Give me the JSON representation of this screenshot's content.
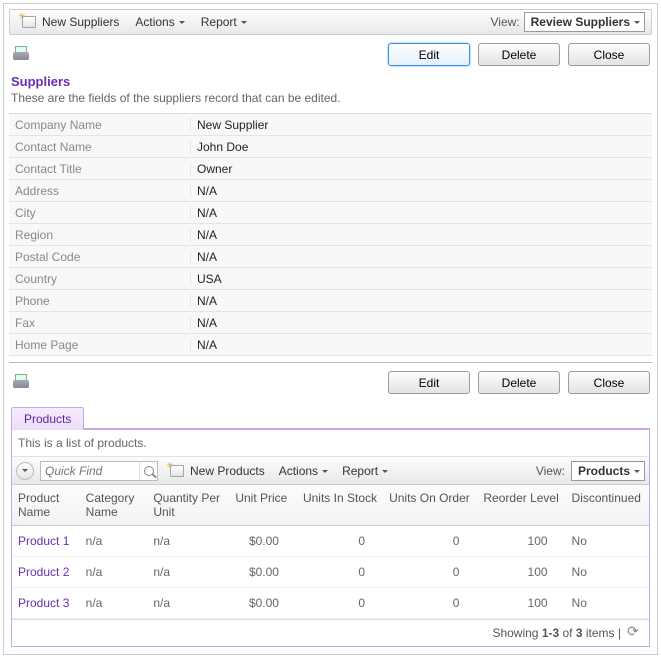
{
  "topToolbar": {
    "newSuppliers": "New Suppliers",
    "actions": "Actions",
    "report": "Report",
    "viewLabel": "View:",
    "viewValue": "Review Suppliers"
  },
  "supplierActions": {
    "edit": "Edit",
    "delete": "Delete",
    "close": "Close"
  },
  "supplierSection": {
    "title": "Suppliers",
    "description": "These are the fields of the suppliers record that can be edited."
  },
  "fields": [
    {
      "label": "Company Name",
      "value": "New Supplier"
    },
    {
      "label": "Contact Name",
      "value": "John Doe"
    },
    {
      "label": "Contact Title",
      "value": "Owner"
    },
    {
      "label": "Address",
      "value": "N/A"
    },
    {
      "label": "City",
      "value": "N/A"
    },
    {
      "label": "Region",
      "value": "N/A"
    },
    {
      "label": "Postal Code",
      "value": "N/A"
    },
    {
      "label": "Country",
      "value": "USA"
    },
    {
      "label": "Phone",
      "value": "N/A"
    },
    {
      "label": "Fax",
      "value": "N/A"
    },
    {
      "label": "Home Page",
      "value": "N/A"
    }
  ],
  "productActions": {
    "edit": "Edit",
    "delete": "Delete",
    "close": "Close"
  },
  "productsTab": "Products",
  "productsDesc": "This is a list of products.",
  "productsToolbar": {
    "quickFindPlaceholder": "Quick Find",
    "newProducts": "New Products",
    "actions": "Actions",
    "report": "Report",
    "viewLabel": "View:",
    "viewValue": "Products"
  },
  "productColumns": {
    "productName": "Product Name",
    "categoryName": "Category Name",
    "qtyPerUnit": "Quantity Per Unit",
    "unitPrice": "Unit Price",
    "unitsInStock": "Units In Stock",
    "unitsOnOrder": "Units On Order",
    "reorderLevel": "Reorder Level",
    "discontinued": "Discontinued"
  },
  "products": [
    {
      "name": "Product 1",
      "category": "n/a",
      "qty": "n/a",
      "price": "$0.00",
      "stock": "0",
      "order": "0",
      "reorder": "100",
      "disc": "No"
    },
    {
      "name": "Product 2",
      "category": "n/a",
      "qty": "n/a",
      "price": "$0.00",
      "stock": "0",
      "order": "0",
      "reorder": "100",
      "disc": "No"
    },
    {
      "name": "Product 3",
      "category": "n/a",
      "qty": "n/a",
      "price": "$0.00",
      "stock": "0",
      "order": "0",
      "reorder": "100",
      "disc": "No"
    }
  ],
  "footer": {
    "prefix": "Showing ",
    "range": "1-3",
    "mid": " of ",
    "total": "3",
    "suffix": " items | "
  }
}
